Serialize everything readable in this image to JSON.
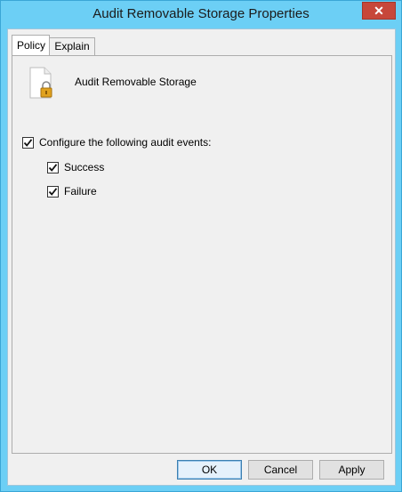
{
  "window": {
    "title": "Audit Removable Storage Properties",
    "close_glyph": "✕"
  },
  "tabs": [
    {
      "label": "Policy",
      "active": true
    },
    {
      "label": "Explain",
      "active": false
    }
  ],
  "policy": {
    "icon": "document-lock-icon",
    "name": "Audit Removable Storage"
  },
  "options": {
    "configure": {
      "label": "Configure the following audit events:",
      "checked": true
    },
    "success": {
      "label": "Success",
      "checked": true
    },
    "failure": {
      "label": "Failure",
      "checked": true
    }
  },
  "buttons": {
    "ok": "OK",
    "cancel": "Cancel",
    "apply": "Apply"
  }
}
